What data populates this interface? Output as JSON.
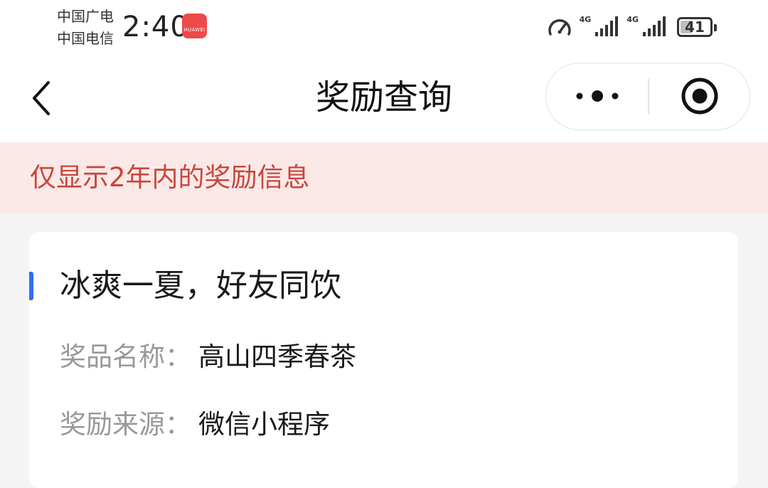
{
  "status_bar": {
    "carrier_1": "中国广电",
    "carrier_2": "中国电信",
    "time": "2:40",
    "app_badge_label": "HUAWEI",
    "network_1": "4G",
    "network_2": "4G",
    "battery_level": "41",
    "battery_fraction": 0.41
  },
  "nav": {
    "title": "奖励查询",
    "back_icon": "chevron-left-icon",
    "more_icon": "more-dots-icon",
    "close_icon": "target-close-icon"
  },
  "notice": {
    "text": "仅显示2年内的奖励信息"
  },
  "reward_card": {
    "title": "冰爽一夏，好友同饮",
    "accent_color": "#2f6df5",
    "rows": [
      {
        "label": "奖品名称：",
        "value": "高山四季春茶"
      },
      {
        "label": "奖励来源：",
        "value": "微信小程序"
      }
    ]
  },
  "colors": {
    "notice_bg": "#fbe9e7",
    "notice_text": "#c9463d",
    "page_bg": "#f4f4f4"
  }
}
